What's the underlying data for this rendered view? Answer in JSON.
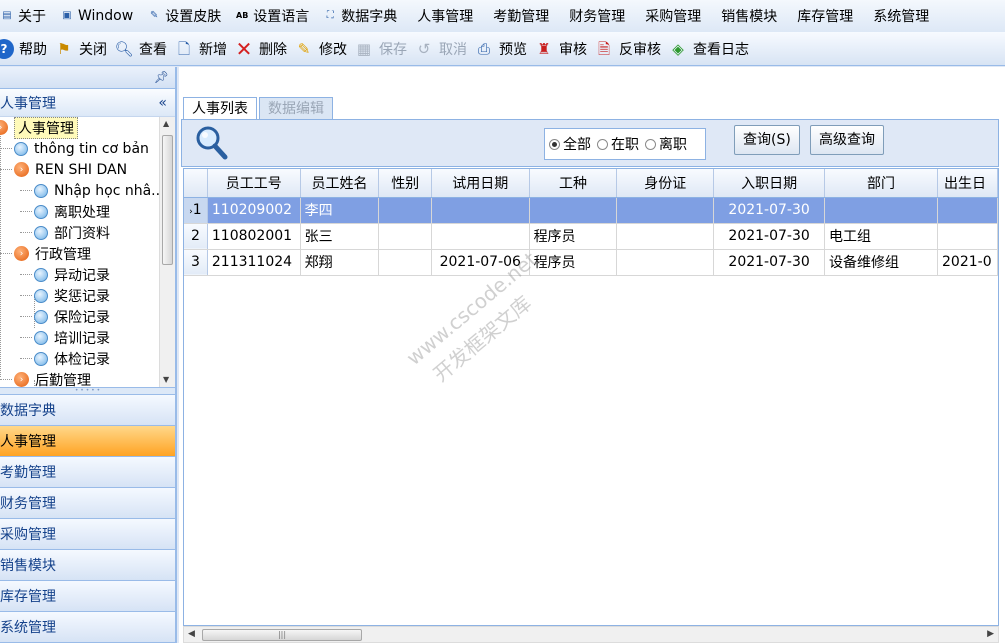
{
  "menubar": [
    {
      "label": "关于",
      "icon": "about-icon"
    },
    {
      "label": "Window",
      "icon": "window-icon"
    },
    {
      "label": "设置皮肤",
      "icon": "skin-icon"
    },
    {
      "label": "设置语言",
      "icon": "language-icon"
    },
    {
      "label": "数据字典",
      "icon": "dictionary-icon"
    },
    {
      "label": "人事管理"
    },
    {
      "label": "考勤管理"
    },
    {
      "label": "财务管理"
    },
    {
      "label": "采购管理"
    },
    {
      "label": "销售模块"
    },
    {
      "label": "库存管理"
    },
    {
      "label": "系统管理"
    }
  ],
  "toolbar": {
    "help": "帮助",
    "close": "关闭",
    "view": "查看",
    "add": "新增",
    "delete": "删除",
    "edit": "修改",
    "save": "保存",
    "cancel": "取消",
    "preview": "预览",
    "audit": "审核",
    "unaudit": "反审核",
    "log": "查看日志"
  },
  "sidebar": {
    "title": "人事管理",
    "tree": [
      {
        "label": "人事管理",
        "type": "group",
        "selected": true
      },
      {
        "label": "thông tin cơ bản",
        "type": "leaf"
      },
      {
        "label": "REN SHI DAN",
        "type": "group"
      },
      {
        "label": "Nhập học nhâ...",
        "type": "leaf"
      },
      {
        "label": "离职处理",
        "type": "leaf"
      },
      {
        "label": "部门资料",
        "type": "leaf"
      },
      {
        "label": "行政管理",
        "type": "group"
      },
      {
        "label": "异动记录",
        "type": "leaf"
      },
      {
        "label": "奖惩记录",
        "type": "leaf"
      },
      {
        "label": "保险记录",
        "type": "leaf"
      },
      {
        "label": "培训记录",
        "type": "leaf"
      },
      {
        "label": "体检记录",
        "type": "leaf"
      },
      {
        "label": "后勤管理",
        "type": "group"
      }
    ],
    "nav": [
      {
        "label": "数据字典",
        "active": false
      },
      {
        "label": "人事管理",
        "active": true
      },
      {
        "label": "考勤管理",
        "active": false
      },
      {
        "label": "财务管理",
        "active": false
      },
      {
        "label": "采购管理",
        "active": false
      },
      {
        "label": "销售模块",
        "active": false
      },
      {
        "label": "库存管理",
        "active": false
      },
      {
        "label": "系统管理",
        "active": false
      }
    ]
  },
  "tabs": {
    "list": "人事列表",
    "edit": "数据编辑"
  },
  "filter": {
    "all": "全部",
    "active": "在职",
    "left": "离职",
    "selected": "all",
    "query_btn": "查询(S)",
    "advanced_btn": "高级查询"
  },
  "grid": {
    "columns": [
      "员工工号",
      "员工姓名",
      "性别",
      "试用日期",
      "工种",
      "身份证",
      "入职日期",
      "部门",
      "出生日"
    ],
    "rows": [
      {
        "num": "1",
        "cells": [
          "110209002",
          "李四",
          "",
          "",
          "",
          "",
          "2021-07-30",
          "",
          ""
        ],
        "selected": true
      },
      {
        "num": "2",
        "cells": [
          "110802001",
          "张三",
          "",
          "",
          "程序员",
          "",
          "2021-07-30",
          "电工组",
          ""
        ],
        "selected": false
      },
      {
        "num": "3",
        "cells": [
          "211311024",
          "郑翔",
          "",
          "2021-07-06",
          "程序员",
          "",
          "2021-07-30",
          "设备维修组",
          "2021-0"
        ],
        "selected": false
      }
    ]
  },
  "watermark": {
    "line1": "www.cscode.net",
    "line2": "开发框架文库"
  },
  "colors": {
    "accent_nav": "#ffa323",
    "grid_selected": "#7f9fe3",
    "border": "#99bbe8"
  }
}
